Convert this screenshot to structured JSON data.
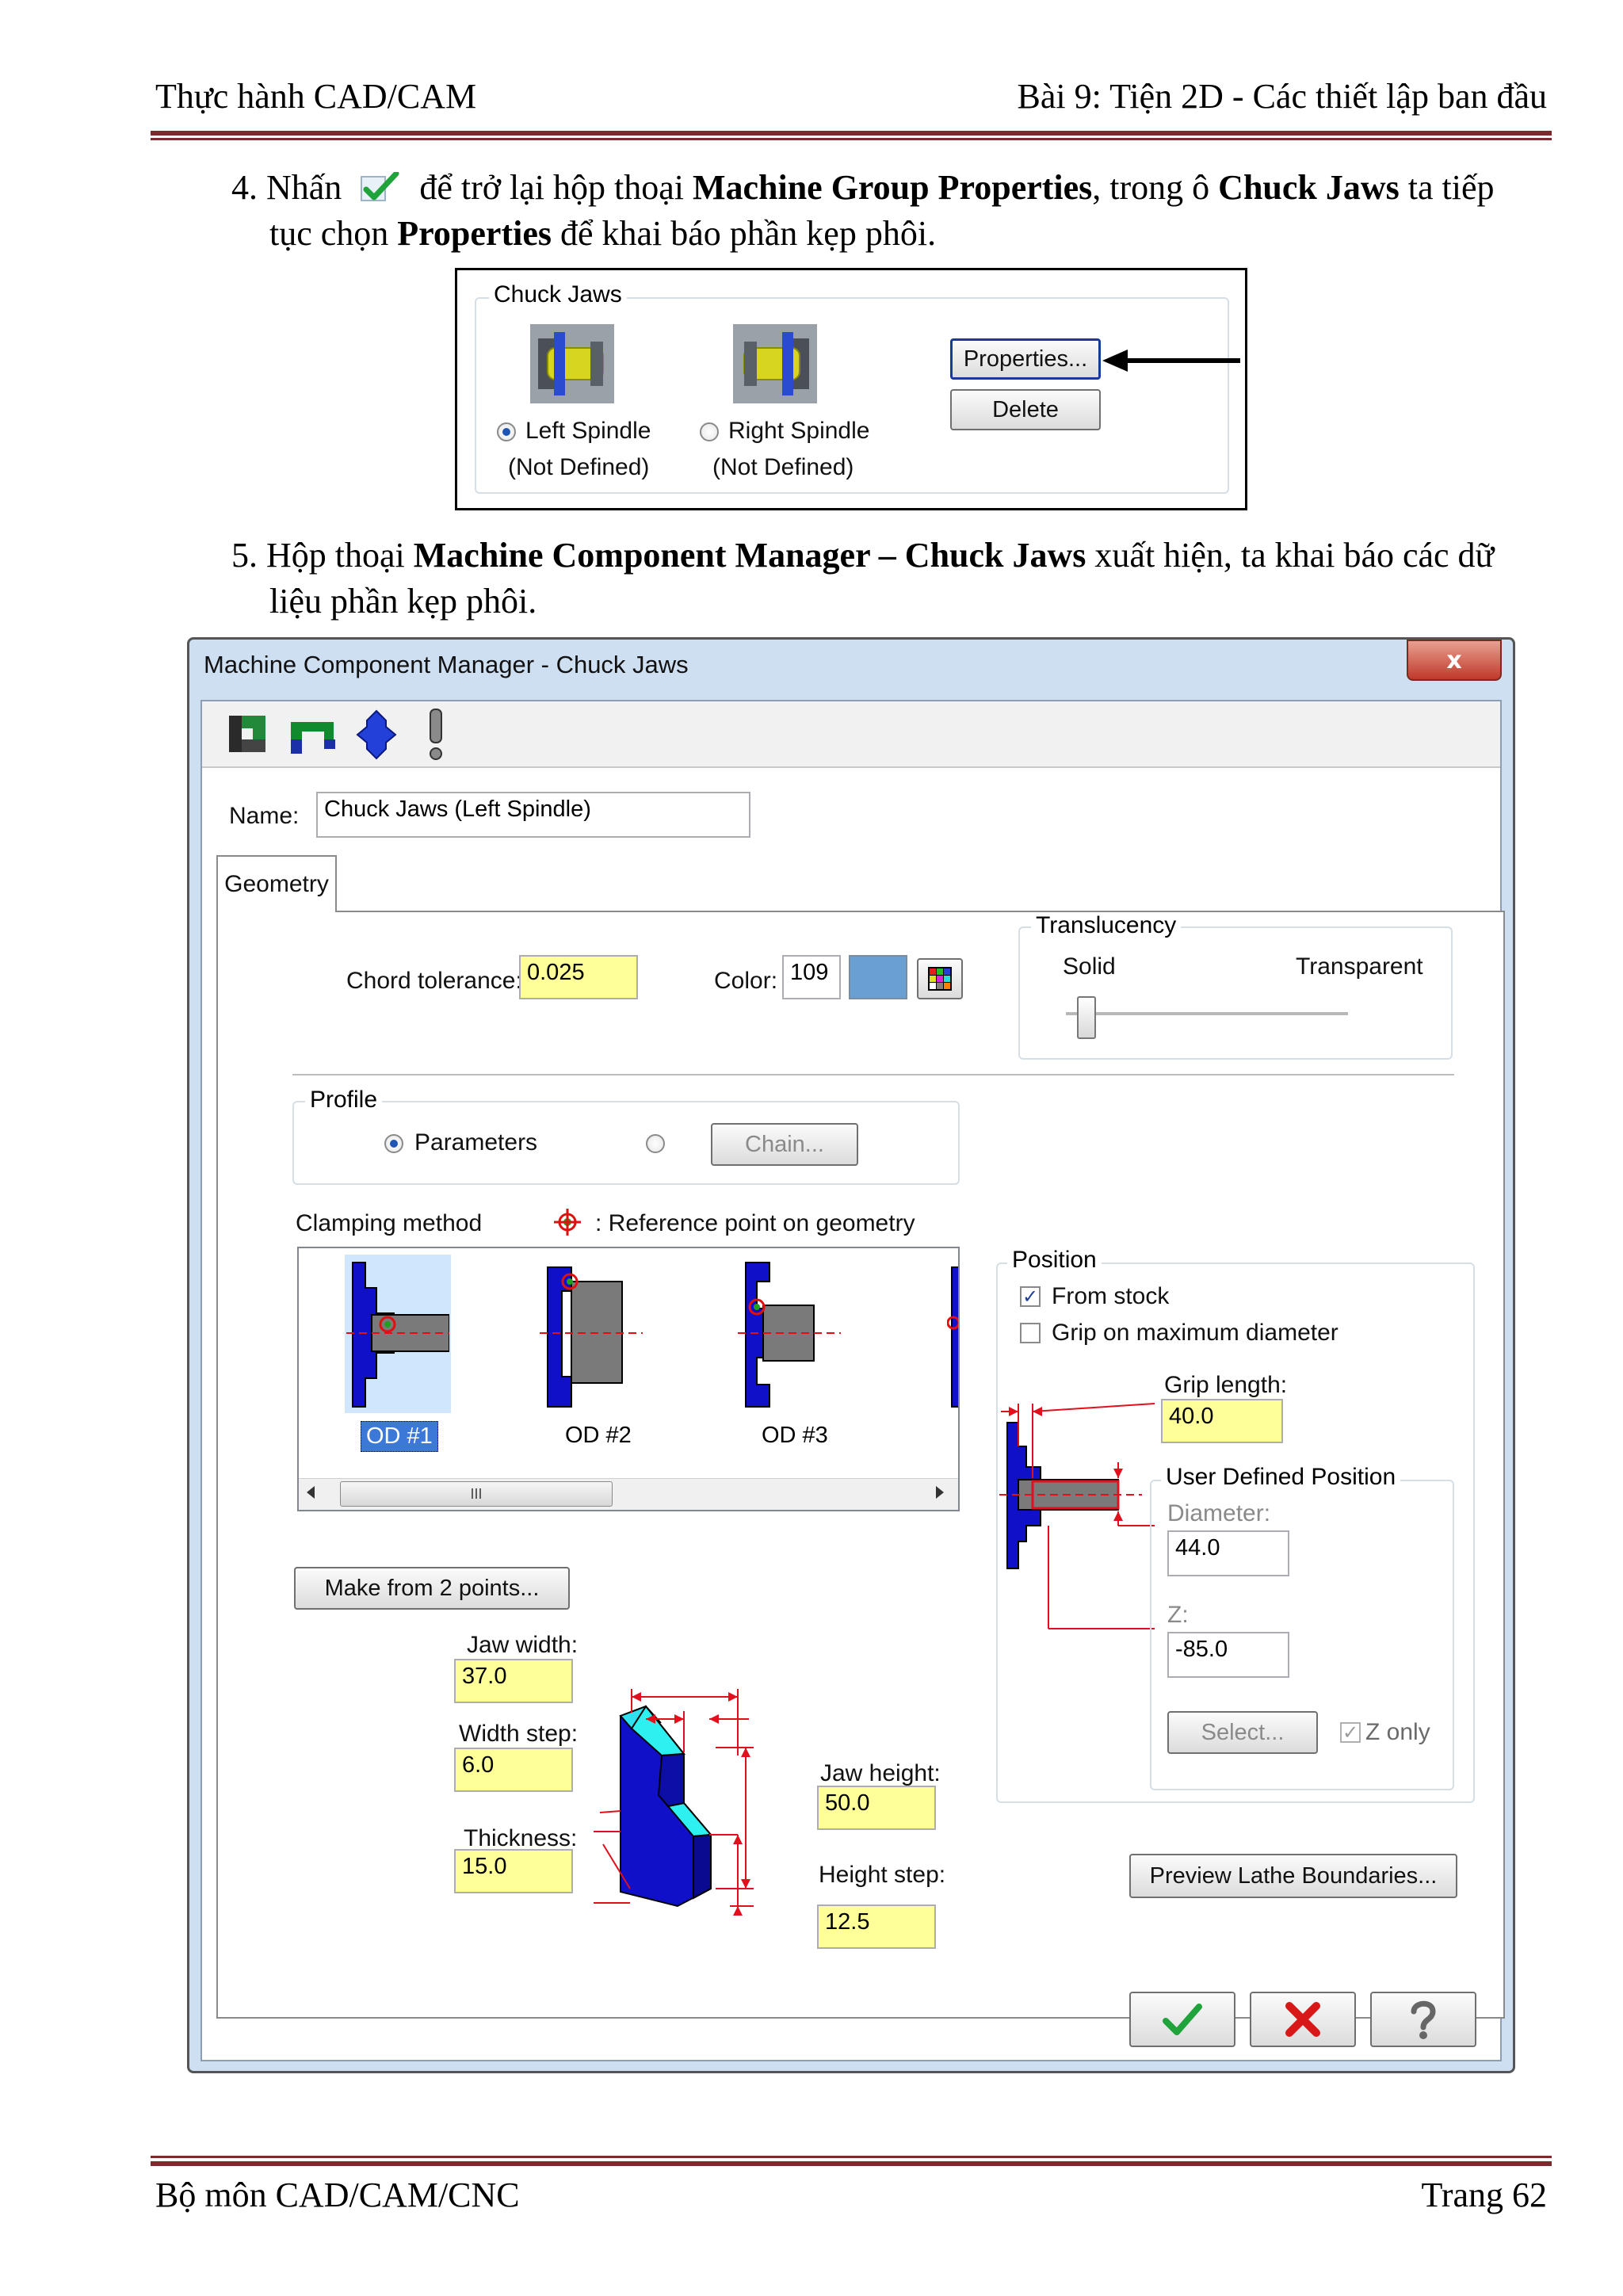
{
  "header": {
    "left": "Thực hành CAD/CAM",
    "right": "Bài 9: Tiện 2D - Các thiết lập ban đầu"
  },
  "footer": {
    "left": "Bộ môn CAD/CAM/CNC",
    "right": "Trang 62"
  },
  "step4": {
    "num": "4.",
    "t1": "Nhấn",
    "t2": "để trở lại hộp thoại",
    "b1": "Machine Group Properties",
    "t3": ", trong ô",
    "b2": "Chuck Jaws",
    "t4": "ta tiếp",
    "t5": "tục chọn",
    "b3": "Properties",
    "t6": "để khai báo phần kẹp phôi."
  },
  "step5": {
    "num": "5.",
    "t1": "Hộp thoại",
    "b1": "Machine Component Manager – Chuck Jaws",
    "t2": "xuất hiện, ta khai báo các dữ",
    "t3": "liệu phần kẹp phôi."
  },
  "chuck_box": {
    "group_label": "Chuck Jaws",
    "left_label": "Left Spindle",
    "left_sub": "(Not Defined)",
    "right_label": "Right Spindle",
    "right_sub": "(Not Defined)",
    "properties_btn": "Properties...",
    "delete_btn": "Delete"
  },
  "dialog": {
    "title": "Machine Component Manager - Chuck Jaws",
    "name_label": "Name:",
    "name_value": "Chuck Jaws (Left Spindle)",
    "tab": "Geometry",
    "chord_label": "Chord tolerance:",
    "chord_value": "0.025",
    "color_label": "Color:",
    "color_value": "109",
    "color_swatch": "#6a9fd4",
    "translucency_label": "Translucency",
    "solid": "Solid",
    "transparent": "Transparent",
    "profile_label": "Profile",
    "parameters": "Parameters",
    "chain_btn": "Chain...",
    "clamping_label": "Clamping method",
    "ref_point": ": Reference point on geometry",
    "od1": "OD #1",
    "od2": "OD #2",
    "od3": "OD #3",
    "scroll_thumb": "III",
    "make_btn": "Make from 2 points...",
    "jaw_width_label": "Jaw width:",
    "jaw_width": "37.0",
    "width_step_label": "Width step:",
    "width_step": "6.0",
    "thickness_label": "Thickness:",
    "thickness": "15.0",
    "jaw_height_label": "Jaw height:",
    "jaw_height": "50.0",
    "height_step_label": "Height step:",
    "height_step": "12.5",
    "position_label": "Position",
    "from_stock": "From stock",
    "grip_max": "Grip on maximum diameter",
    "grip_length_label": "Grip length:",
    "grip_length": "40.0",
    "udp_label": "User Defined Position",
    "diameter_label": "Diameter:",
    "diameter": "44.0",
    "z_label": "Z:",
    "z_value": "-85.0",
    "select_btn": "Select...",
    "z_only": "Z only",
    "preview_btn": "Preview Lathe Boundaries...",
    "close_glyph": "x"
  },
  "colors": {
    "rule": "#7b2b2b",
    "jaw_blue": "#1010c8",
    "dim_red": "#e0101c",
    "field_yellow": "#ffff99",
    "title_bar": "#c9daf0"
  }
}
